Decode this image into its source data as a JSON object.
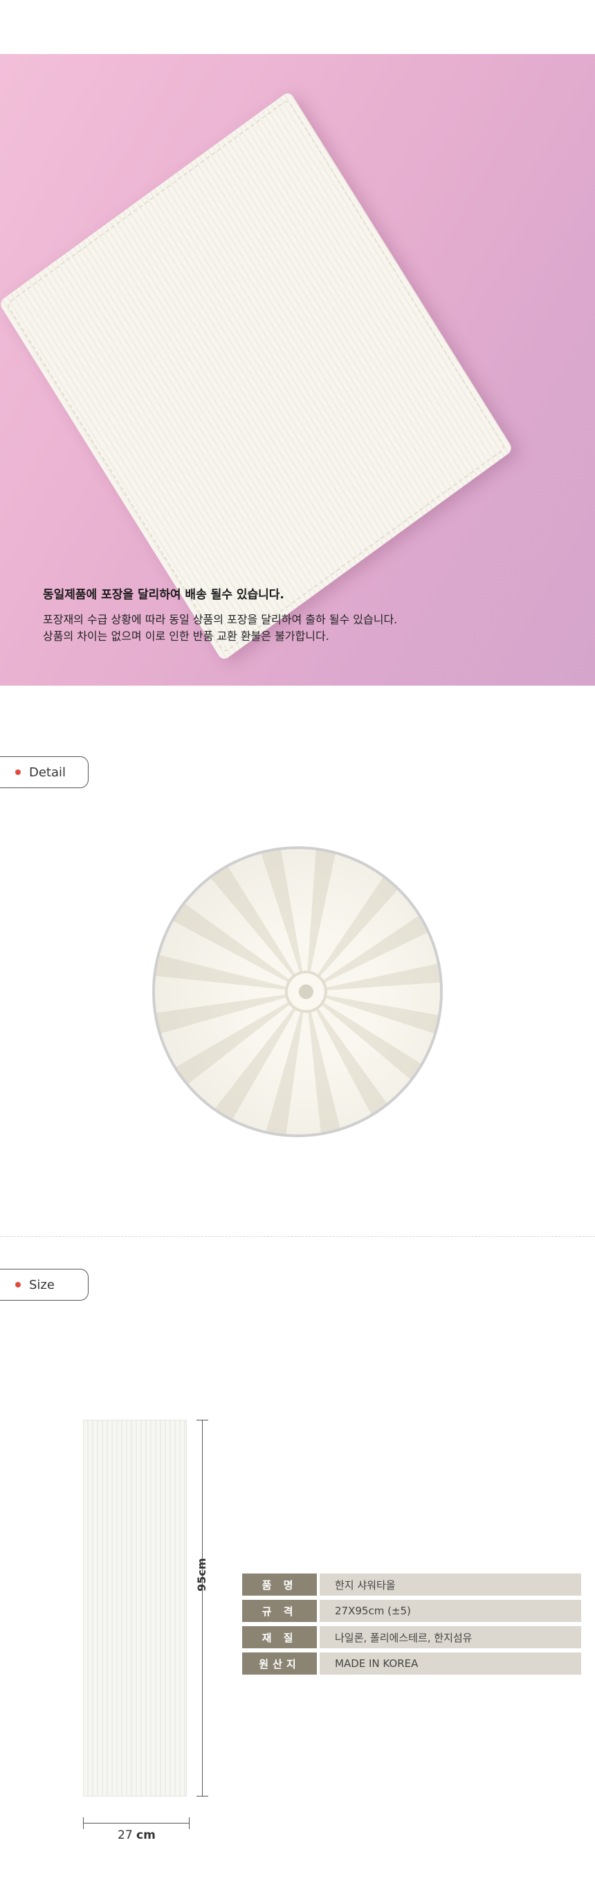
{
  "hero": {
    "title": "동일제품에 포장을 달리하여 배송 될수 있습니다.",
    "line1": "포장재의 수급 상황에 따라 동일 상품의 포장을 달리하여 출하 될수 있습니다.",
    "line2": "상품의 차이는 없으며 이로 인한 반품 교환 환불은 불가합니다."
  },
  "sections": {
    "detail_label": "Detail",
    "size_label": "Size"
  },
  "dimensions": {
    "height_label": "95cm",
    "width_value": "27",
    "width_unit": "cm"
  },
  "spec": [
    {
      "key": "품 명",
      "value": "한지 샤워타올"
    },
    {
      "key": "규 격",
      "value": "27X95cm (±5)"
    },
    {
      "key": "재 질",
      "value": "나일론, 폴리에스테르, 한지섬유"
    },
    {
      "key": "원산지",
      "value": "MADE IN KOREA"
    }
  ],
  "colors": {
    "accent_dot": "#e24a3c",
    "spec_key_bg": "#8c8473",
    "spec_val_bg": "#dcd8d0"
  }
}
